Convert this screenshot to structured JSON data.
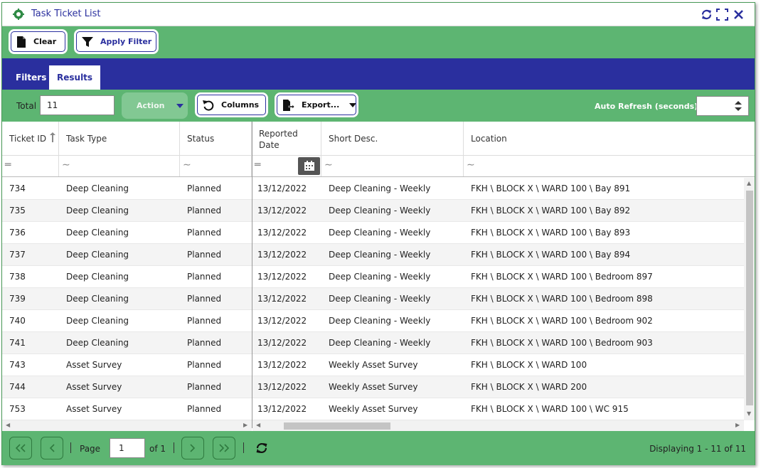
{
  "window": {
    "title": "Task Ticket List",
    "icons": [
      "gear-app-icon",
      "refresh-icon",
      "maximize-icon",
      "close-icon"
    ]
  },
  "toolbar": {
    "clear_label": "Clear",
    "apply_filter_label": "Apply Filter"
  },
  "tabs": [
    {
      "label": "Filters",
      "active": false
    },
    {
      "label": "Results",
      "active": true
    }
  ],
  "results_bar": {
    "total_label": "Total",
    "total_value": "11",
    "action_label": "Action",
    "columns_label": "Columns",
    "export_label": "Export...",
    "auto_refresh_label": "Auto Refresh (seconds)",
    "auto_refresh_value": ""
  },
  "grid": {
    "columns": [
      {
        "label": "Ticket ID",
        "sort": "ascending"
      },
      {
        "label": "Task Type"
      },
      {
        "label": "Status"
      },
      {
        "label": "Reported Date"
      },
      {
        "label": "Short Desc."
      },
      {
        "label": "Location"
      }
    ],
    "rows": [
      {
        "id": "734",
        "type": "Deep Cleaning",
        "status": "Planned",
        "date": "13/12/2022",
        "desc": "Deep Cleaning - Weekly",
        "location": "FKH \\ BLOCK X \\ WARD 100 \\ Bay 891"
      },
      {
        "id": "735",
        "type": "Deep Cleaning",
        "status": "Planned",
        "date": "13/12/2022",
        "desc": "Deep Cleaning - Weekly",
        "location": "FKH \\ BLOCK X \\ WARD 100 \\ Bay 892"
      },
      {
        "id": "736",
        "type": "Deep Cleaning",
        "status": "Planned",
        "date": "13/12/2022",
        "desc": "Deep Cleaning - Weekly",
        "location": "FKH \\ BLOCK X \\ WARD 100 \\ Bay 893"
      },
      {
        "id": "737",
        "type": "Deep Cleaning",
        "status": "Planned",
        "date": "13/12/2022",
        "desc": "Deep Cleaning - Weekly",
        "location": "FKH \\ BLOCK X \\ WARD 100 \\ Bay 894"
      },
      {
        "id": "738",
        "type": "Deep Cleaning",
        "status": "Planned",
        "date": "13/12/2022",
        "desc": "Deep Cleaning - Weekly",
        "location": "FKH \\ BLOCK X \\ WARD 100 \\ Bedroom 897"
      },
      {
        "id": "739",
        "type": "Deep Cleaning",
        "status": "Planned",
        "date": "13/12/2022",
        "desc": "Deep Cleaning - Weekly",
        "location": "FKH \\ BLOCK X \\ WARD 100 \\ Bedroom 898"
      },
      {
        "id": "740",
        "type": "Deep Cleaning",
        "status": "Planned",
        "date": "13/12/2022",
        "desc": "Deep Cleaning - Weekly",
        "location": "FKH \\ BLOCK X \\ WARD 100 \\ Bedroom 902"
      },
      {
        "id": "741",
        "type": "Deep Cleaning",
        "status": "Planned",
        "date": "13/12/2022",
        "desc": "Deep Cleaning - Weekly",
        "location": "FKH \\ BLOCK X \\ WARD 100 \\ Bedroom 903"
      },
      {
        "id": "743",
        "type": "Asset Survey",
        "status": "Planned",
        "date": "13/12/2022",
        "desc": "Weekly Asset Survey",
        "location": "FKH \\ BLOCK X \\ WARD 100"
      },
      {
        "id": "744",
        "type": "Asset Survey",
        "status": "Planned",
        "date": "13/12/2022",
        "desc": "Weekly Asset Survey",
        "location": "FKH \\ BLOCK X \\ WARD 200"
      },
      {
        "id": "753",
        "type": "Asset Survey",
        "status": "Planned",
        "date": "13/12/2022",
        "desc": "Weekly Asset Survey",
        "location": "FKH \\ BLOCK X \\ WARD 100 \\ WC 915"
      }
    ]
  },
  "pager": {
    "page_label": "Page",
    "page_value": "1",
    "of_label": "of 1",
    "displaying": "Displaying 1 - 11 of 11"
  },
  "colors": {
    "brand_green": "#5db572",
    "brand_navy": "#2a2f9e"
  }
}
